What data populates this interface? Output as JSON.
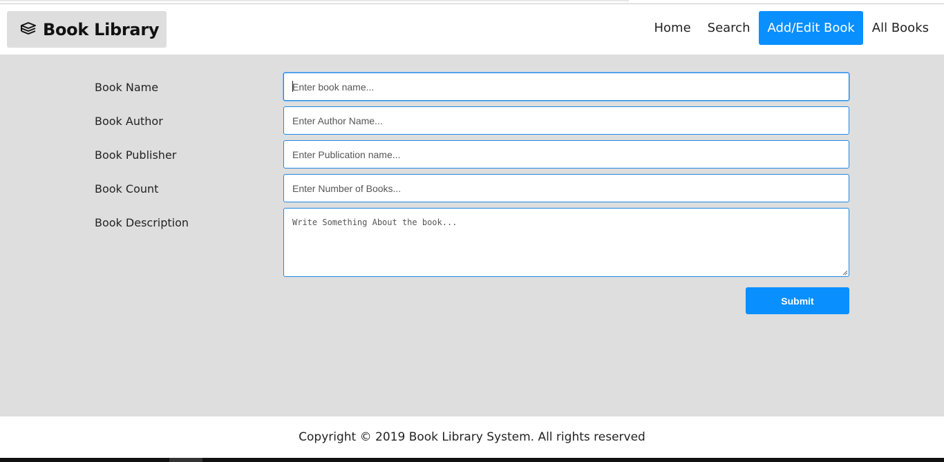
{
  "brand": {
    "name": "Book Library",
    "icon": "books-stack-icon"
  },
  "nav": {
    "items": [
      {
        "label": "Home"
      },
      {
        "label": "Search"
      },
      {
        "label": "Add/Edit Book",
        "active": true
      },
      {
        "label": "All Books"
      }
    ]
  },
  "form": {
    "book_name": {
      "label": "Book Name",
      "placeholder": "Enter book name...",
      "value": ""
    },
    "book_author": {
      "label": "Book Author",
      "placeholder": "Enter Author Name...",
      "value": ""
    },
    "book_publisher": {
      "label": "Book Publisher",
      "placeholder": "Enter Publication name...",
      "value": ""
    },
    "book_count": {
      "label": "Book Count",
      "placeholder": "Enter Number of Books...",
      "value": ""
    },
    "book_description": {
      "label": "Book Description",
      "placeholder": "Write Something About the book...",
      "value": ""
    },
    "submit_label": "Submit"
  },
  "footer": {
    "text": "Copyright © 2019 Book Library System. All rights reserved"
  },
  "colors": {
    "accent": "#0a8fff",
    "content_bg": "#dedede",
    "input_border": "#1f86e0"
  }
}
